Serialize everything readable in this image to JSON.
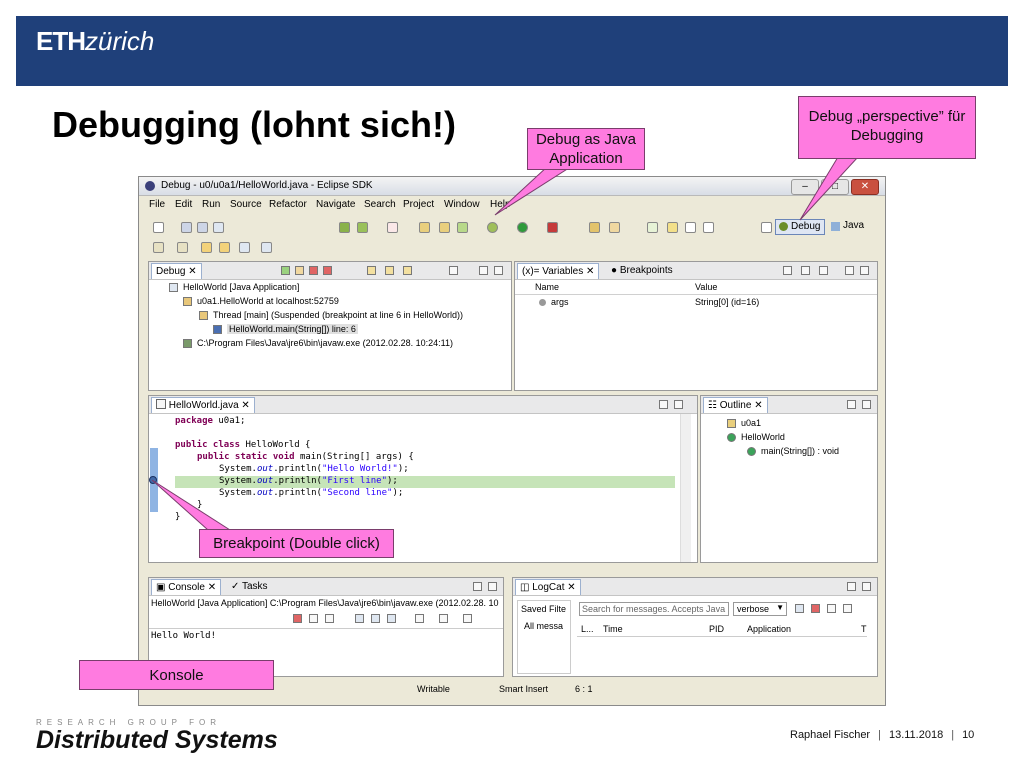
{
  "slide": {
    "logo": {
      "bold": "ETH",
      "italic": "zürich"
    },
    "title": "Debugging (lohnt sich!)",
    "callouts": {
      "debug_as_java": "Debug as Java Application",
      "perspective": "Debug „perspective” für Debugging",
      "breakpoint": "Breakpoint (Double click)",
      "konsole": "Konsole"
    },
    "footer": {
      "group": "RESEARCH GROUP FOR",
      "name": "Distributed Systems",
      "author": "Raphael Fischer",
      "date": "13.11.2018",
      "page": "10"
    }
  },
  "eclipse": {
    "window_title": "Debug - u0/u0a1/HelloWorld.java - Eclipse SDK",
    "menu": [
      "File",
      "Edit",
      "Run",
      "Source",
      "Refactor",
      "Navigate",
      "Search",
      "Project",
      "Window",
      "Help"
    ],
    "perspectives": {
      "debug": "Debug",
      "java": "Java"
    },
    "debug_view": {
      "tab": "Debug",
      "tree": [
        "HelloWorld [Java Application]",
        "u0a1.HelloWorld at localhost:52759",
        "Thread [main] (Suspended (breakpoint at line 6 in HelloWorld))",
        "HelloWorld.main(String[]) line: 6",
        "C:\\Program Files\\Java\\jre6\\bin\\javaw.exe (2012.02.28. 10:24:11)"
      ]
    },
    "variables_view": {
      "tabs": [
        "Variables",
        "Breakpoints"
      ],
      "columns": [
        "Name",
        "Value"
      ],
      "rows": [
        {
          "name": "args",
          "value": "String[0]  (id=16)"
        }
      ]
    },
    "editor": {
      "tab": "HelloWorld.java",
      "code": {
        "l1_kw": "package",
        "l1_rest": " u0a1;",
        "l2_kw": "public class",
        "l2_rest": " HelloWorld {",
        "l3_kw": "public static void",
        "l3_rest": " main(String[] args) {",
        "sys": "System.",
        "out": "out",
        "println": ".println(",
        "s1": "\"Hello World!\"",
        "s2": "\"First line\"",
        "s3": "\"Second line\"",
        "end_stmt": ");",
        "close_inner": "}",
        "close_outer": "}"
      }
    },
    "outline": {
      "tab": "Outline",
      "items": [
        "u0a1",
        "HelloWorld",
        "main(String[]) : void"
      ]
    },
    "console": {
      "tabs": [
        "Console",
        "Tasks"
      ],
      "header": "HelloWorld [Java Application] C:\\Program Files\\Java\\jre6\\bin\\javaw.exe (2012.02.28. 10",
      "output": "Hello World!"
    },
    "logcat": {
      "tab": "LogCat",
      "saved_filters": "Saved Filte",
      "all_messages": "All messa",
      "search_placeholder": "Search for messages. Accepts Java",
      "level": "verbose",
      "columns": [
        "L...",
        "Time",
        "PID",
        "Application",
        "T"
      ]
    },
    "status": {
      "writable": "Writable",
      "insert": "Smart Insert",
      "position": "6 : 1"
    }
  }
}
